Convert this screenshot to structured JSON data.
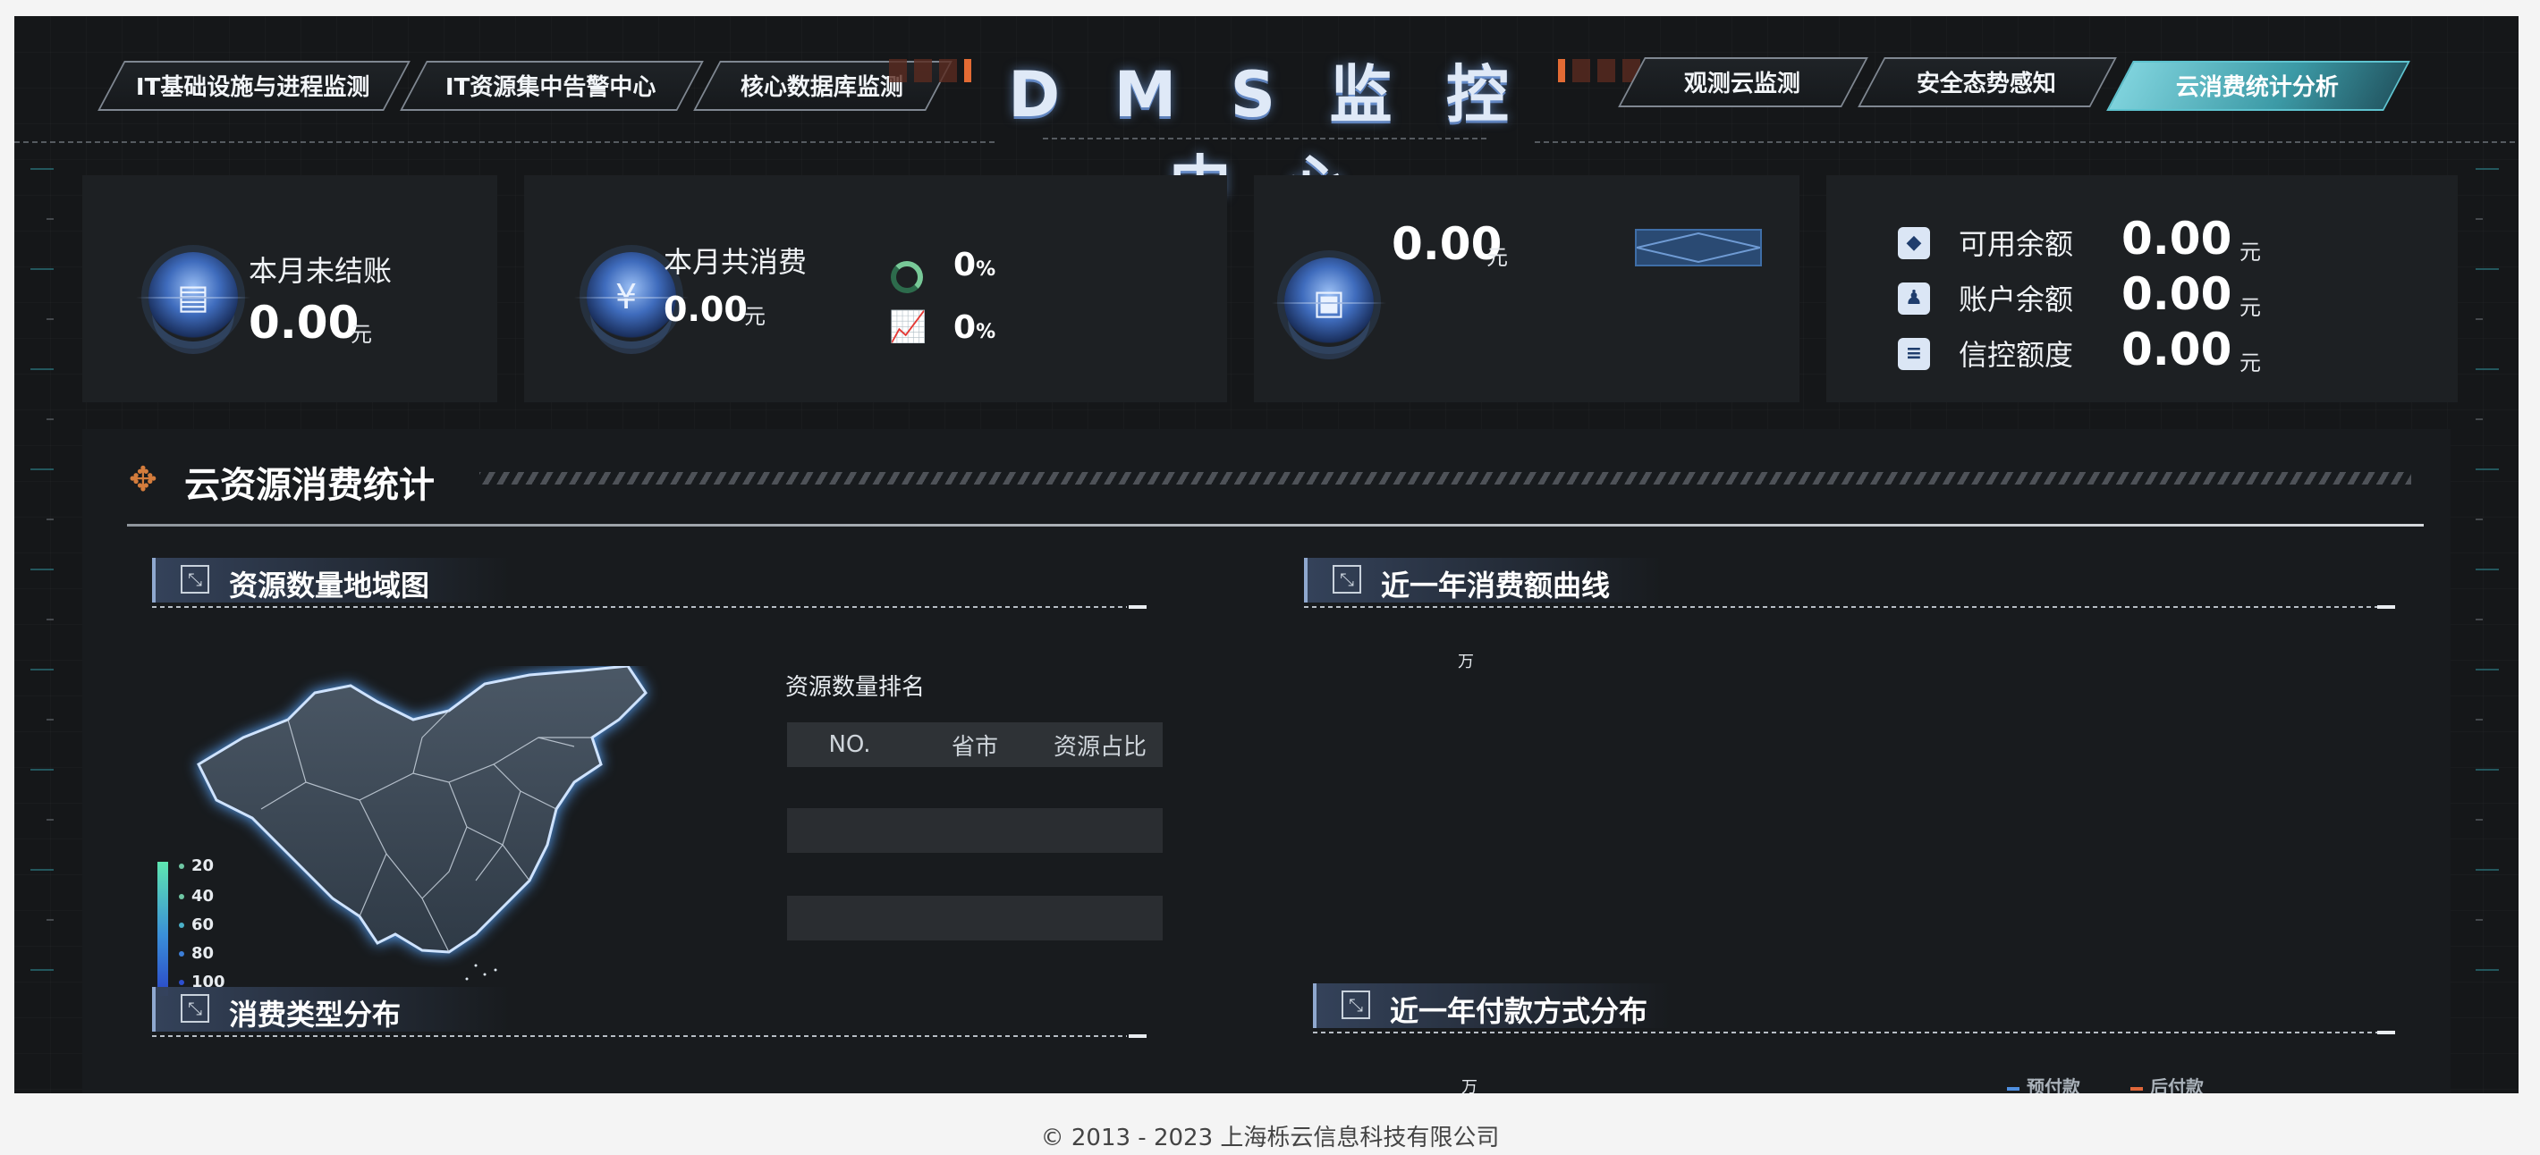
{
  "header": {
    "title": "D M S 监 控 中 心",
    "tabs": [
      {
        "label": "IT基础设施与进程监测",
        "active": false
      },
      {
        "label": "IT资源集中告警中心",
        "active": false
      },
      {
        "label": "核心数据库监测",
        "active": false
      },
      {
        "label": "观测云监测",
        "active": false
      },
      {
        "label": "安全态势感知",
        "active": false
      },
      {
        "label": "云消费统计分析",
        "active": true
      }
    ]
  },
  "stats": {
    "unsettled": {
      "label": "本月未结账",
      "value": "0.00",
      "unit": "元",
      "icon": "bill-icon"
    },
    "consumption": {
      "label": "本月共消费",
      "value": "0.00",
      "unit": "元",
      "icon": "money-bag-icon",
      "ratio1": {
        "value": "0",
        "unit": "%",
        "icon": "ring-progress-icon"
      },
      "ratio2": {
        "value": "0",
        "unit": "%",
        "icon": "trend-chart-icon"
      }
    },
    "third": {
      "value": "0.00",
      "unit": "元",
      "icon": "wallet-icon"
    },
    "balances": [
      {
        "label": "可用余额",
        "value": "0.00",
        "unit": "元",
        "icon": "available-balance-icon"
      },
      {
        "label": "账户余额",
        "value": "0.00",
        "unit": "元",
        "icon": "account-balance-icon"
      },
      {
        "label": "信控额度",
        "value": "0.00",
        "unit": "元",
        "icon": "credit-limit-icon"
      }
    ]
  },
  "section": {
    "title": "云资源消费统计",
    "panels": {
      "region": {
        "title": "资源数量地域图"
      },
      "yearly_curve": {
        "title": "近一年消费额曲线",
        "unit": "万"
      },
      "consumption_type": {
        "title": "消费类型分布"
      },
      "payment_method": {
        "title": "近一年付款方式分布",
        "unit": "万"
      }
    },
    "map_legend": [
      "20",
      "40",
      "60",
      "80",
      "100"
    ],
    "ranking": {
      "title": "资源数量排名",
      "columns": [
        "NO.",
        "省市",
        "资源占比"
      ]
    },
    "payment_legend": [
      {
        "label": "预付款",
        "color": "#4f8fe0"
      },
      {
        "label": "后付款",
        "color": "#e0673a"
      }
    ]
  },
  "footer": {
    "text": "© 2013 - 2023 上海栎云信息科技有限公司"
  }
}
